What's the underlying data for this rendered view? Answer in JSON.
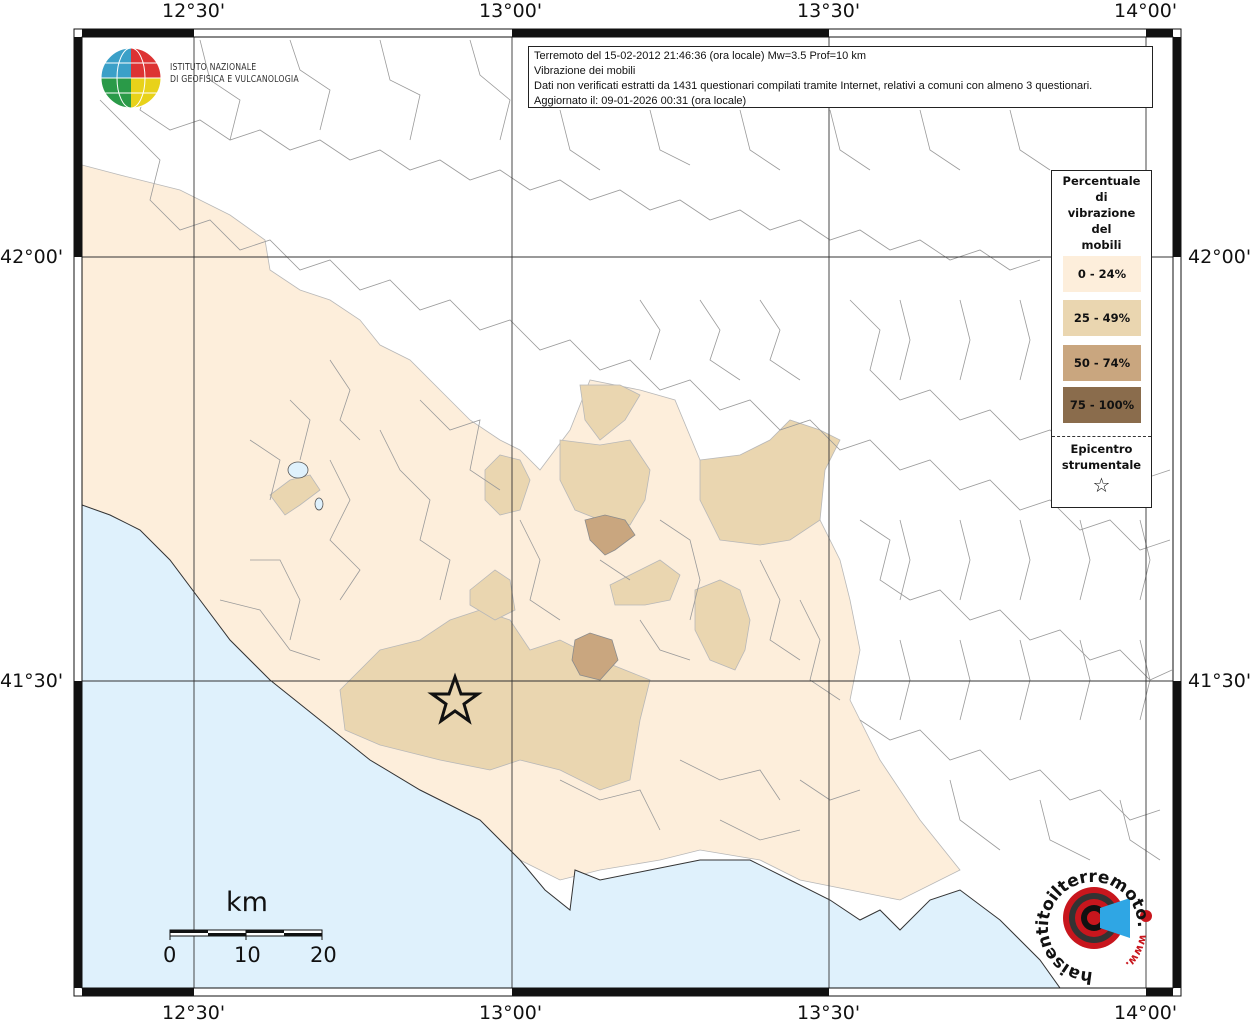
{
  "map": {
    "top_longitude_labels": [
      "12°30'",
      "13°00'",
      "13°30'",
      "14°00'"
    ],
    "bottom_longitude_labels": [
      "12°30'",
      "13°00'",
      "13°30'",
      "14°00'"
    ],
    "left_latitude_labels": [
      "42°00'",
      "41°30'"
    ],
    "right_latitude_labels": [
      "42°00'",
      "41°30'"
    ],
    "sea_color": "#dff1fc",
    "land_color": "#ffffff",
    "boundary_color": "#9a9a9a",
    "class_colors": [
      "#fdeedb",
      "#ead6b0",
      "#c9a67f",
      "#8a6c4c"
    ]
  },
  "info": {
    "line1": "Terremoto del 15-02-2012 21:46:36 (ora locale) Mw=3.5 Prof=10 km",
    "line2": "Vibrazione dei mobili",
    "line3": "Dati non verificati estratti da 1431 questionari compilati tramite Internet, relativi a comuni con almeno 3 questionari.",
    "line4": "Aggiornato il: 09-01-2026 00:31 (ora locale)"
  },
  "institute": {
    "name_line1": "ISTITUTO NAZIONALE",
    "name_line2": "DI GEOFISICA E VULCANOLOGIA"
  },
  "legend": {
    "title_lines": [
      "Percentuale",
      "di",
      "vibrazione",
      "del",
      "mobili"
    ],
    "classes": [
      {
        "label": "0 - 24%",
        "color": "#fdeedb"
      },
      {
        "label": "25 - 49%",
        "color": "#ead6b0"
      },
      {
        "label": "50 - 74%",
        "color": "#c9a67f"
      },
      {
        "label": "75 - 100%",
        "color": "#8a6c4c"
      }
    ],
    "epicenter_lines": [
      "Epicentro",
      "strumentale"
    ],
    "epicenter_symbol": "☆"
  },
  "scale_bar": {
    "title": "km",
    "labels": [
      "0",
      "10",
      "20"
    ]
  },
  "badge": {
    "text": "haisentitoilterremoto.it",
    "url_text": "www."
  }
}
